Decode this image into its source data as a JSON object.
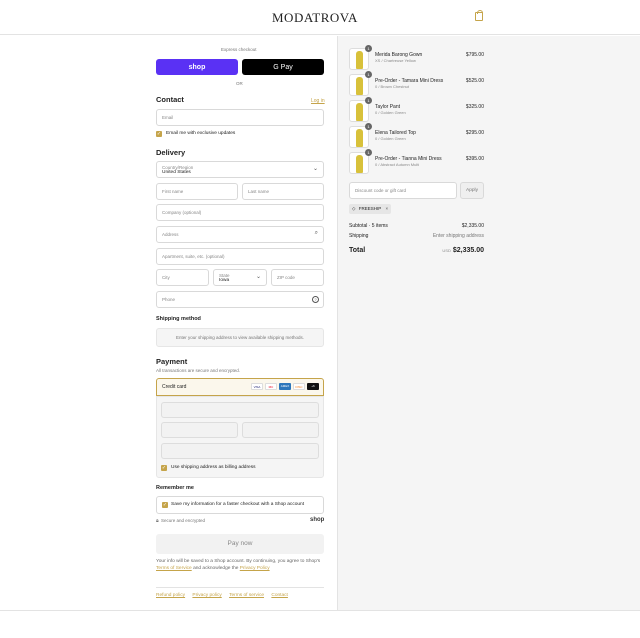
{
  "header": {
    "logo": "MODATROVA",
    "bag_icon": "shopping-bag-icon"
  },
  "express": {
    "label": "Express checkout",
    "shop_label": "shop",
    "gpay_label": "G Pay",
    "or_label": "OR"
  },
  "contact": {
    "heading": "Contact",
    "login_link": "Log in",
    "email_placeholder": "Email",
    "updates_label": "Email me with exclusive updates"
  },
  "delivery": {
    "heading": "Delivery",
    "country_label": "Country/Region",
    "country_value": "United States",
    "first_name": "First name",
    "last_name": "Last name",
    "company": "Company (optional)",
    "address": "Address",
    "apartment": "Apartment, suite, etc. (optional)",
    "city": "City",
    "state_label": "State",
    "state_value": "Iowa",
    "zip": "ZIP code",
    "phone": "Phone"
  },
  "shipping": {
    "heading": "Shipping method",
    "message": "Enter your shipping address to view available shipping methods."
  },
  "payment": {
    "heading": "Payment",
    "subtitle": "All transactions are secure and encrypted.",
    "credit_card_label": "Credit card",
    "more_cards": "+6",
    "card_brands": [
      "VISA",
      "MC",
      "AMEX",
      "DISC"
    ],
    "billing_label": "Use shipping address as billing address"
  },
  "remember": {
    "heading": "Remember me",
    "save_label": "Save my information for a faster checkout with a Shop account",
    "secure_label": "Secure and encrypted",
    "shop_logo": "shop"
  },
  "pay_button": "Pay now",
  "legal": {
    "text1": "Your info will be saved to a Shop account. By continuing, you agree to Shop's",
    "terms": "Terms of Service",
    "text2": "and acknowledge the",
    "privacy": "Privacy Policy"
  },
  "footer_links": [
    "Refund policy",
    "Privacy policy",
    "Terms of service",
    "Contact"
  ],
  "order": {
    "items": [
      {
        "qty": "1",
        "name": "Merida Barong Gown",
        "variant": "XS / Chartreuse Yellow",
        "price": "$795.00"
      },
      {
        "qty": "1",
        "name": "Pre-Order - Tamara Mini Dress",
        "variant": "0 / Brown Chestnut",
        "price": "$525.00"
      },
      {
        "qty": "1",
        "name": "Taylor Pant",
        "variant": "0 / Golden Green",
        "price": "$325.00"
      },
      {
        "qty": "1",
        "name": "Elena Tailored Top",
        "variant": "0 / Golden Green",
        "price": "$295.00"
      },
      {
        "qty": "1",
        "name": "Pre-Order - Tianna Mini Dress",
        "variant": "0 / Abstract Autumn Multi",
        "price": "$395.00"
      }
    ],
    "discount_placeholder": "Discount code or gift card",
    "apply_label": "Apply",
    "code_tag": "FREESHIP",
    "subtotal_label": "Subtotal · 5 items",
    "subtotal_value": "$2,335.00",
    "shipping_label": "Shipping",
    "shipping_value": "Enter shipping address",
    "total_label": "Total",
    "currency": "USD",
    "total_value": "$2,335.00"
  },
  "colors": {
    "accent": "#c5a44a",
    "shop_purple": "#5a31f4"
  }
}
